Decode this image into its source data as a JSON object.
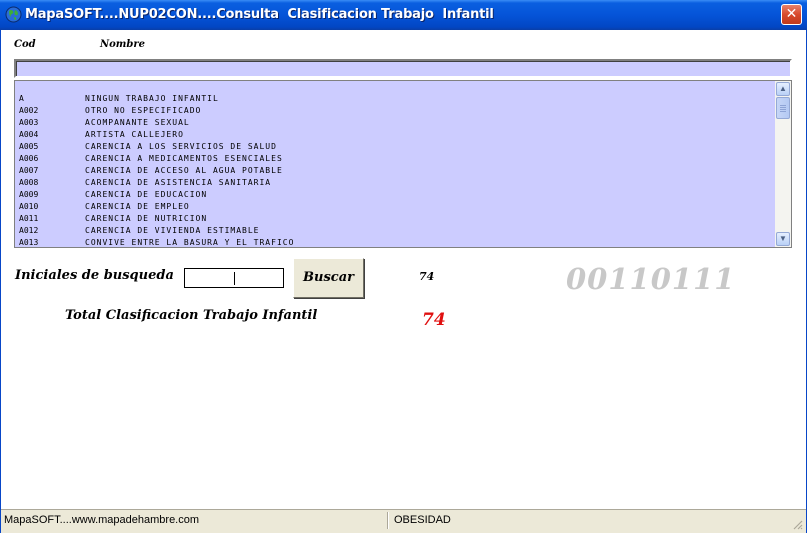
{
  "window": {
    "title": "MapaSOFT....NUP02CON....Consulta  Clasificacion Trabajo  Infantil",
    "close_label": "✕"
  },
  "columns": {
    "code_header": "Cod",
    "name_header": "Nombre"
  },
  "list": {
    "rows": [
      {
        "code": "A",
        "name": "NINGUN TRABAJO INFANTIL"
      },
      {
        "code": "A002",
        "name": "OTRO NO ESPECIFICADO"
      },
      {
        "code": "A003",
        "name": "ACOMPANANTE SEXUAL"
      },
      {
        "code": "A004",
        "name": "ARTISTA CALLEJERO"
      },
      {
        "code": "A005",
        "name": "CARENCIA A LOS SERVICIOS DE SALUD"
      },
      {
        "code": "A006",
        "name": "CARENCIA A MEDICAMENTOS ESENCIALES"
      },
      {
        "code": "A007",
        "name": "CARENCIA DE ACCESO AL AGUA POTABLE"
      },
      {
        "code": "A008",
        "name": "CARENCIA DE ASISTENCIA SANITARIA"
      },
      {
        "code": "A009",
        "name": "CARENCIA DE EDUCACION"
      },
      {
        "code": "A010",
        "name": "CARENCIA DE EMPLEO"
      },
      {
        "code": "A011",
        "name": "CARENCIA DE NUTRICION"
      },
      {
        "code": "A012",
        "name": "CARENCIA DE VIVIENDA ESTIMABLE"
      },
      {
        "code": "A013",
        "name": "CONVIVE ENTRE LA BASURA Y EL TRAFICO"
      }
    ],
    "scroll_up": "▲",
    "scroll_down": "▼"
  },
  "search": {
    "label": "Iniciales de busqueda",
    "value": "",
    "button_label": "Buscar",
    "count": "74"
  },
  "binary_code": "00110111",
  "total": {
    "label": "Total  Clasificacion Trabajo Infantil",
    "value": "74"
  },
  "status": {
    "left_text": "MapaSOFT....www.mapadehambre.com",
    "center_text": "OBESIDAD"
  },
  "colors": {
    "list_background": "#ccccff",
    "total_value": "#e01010",
    "titlebar": "#0554d8"
  }
}
